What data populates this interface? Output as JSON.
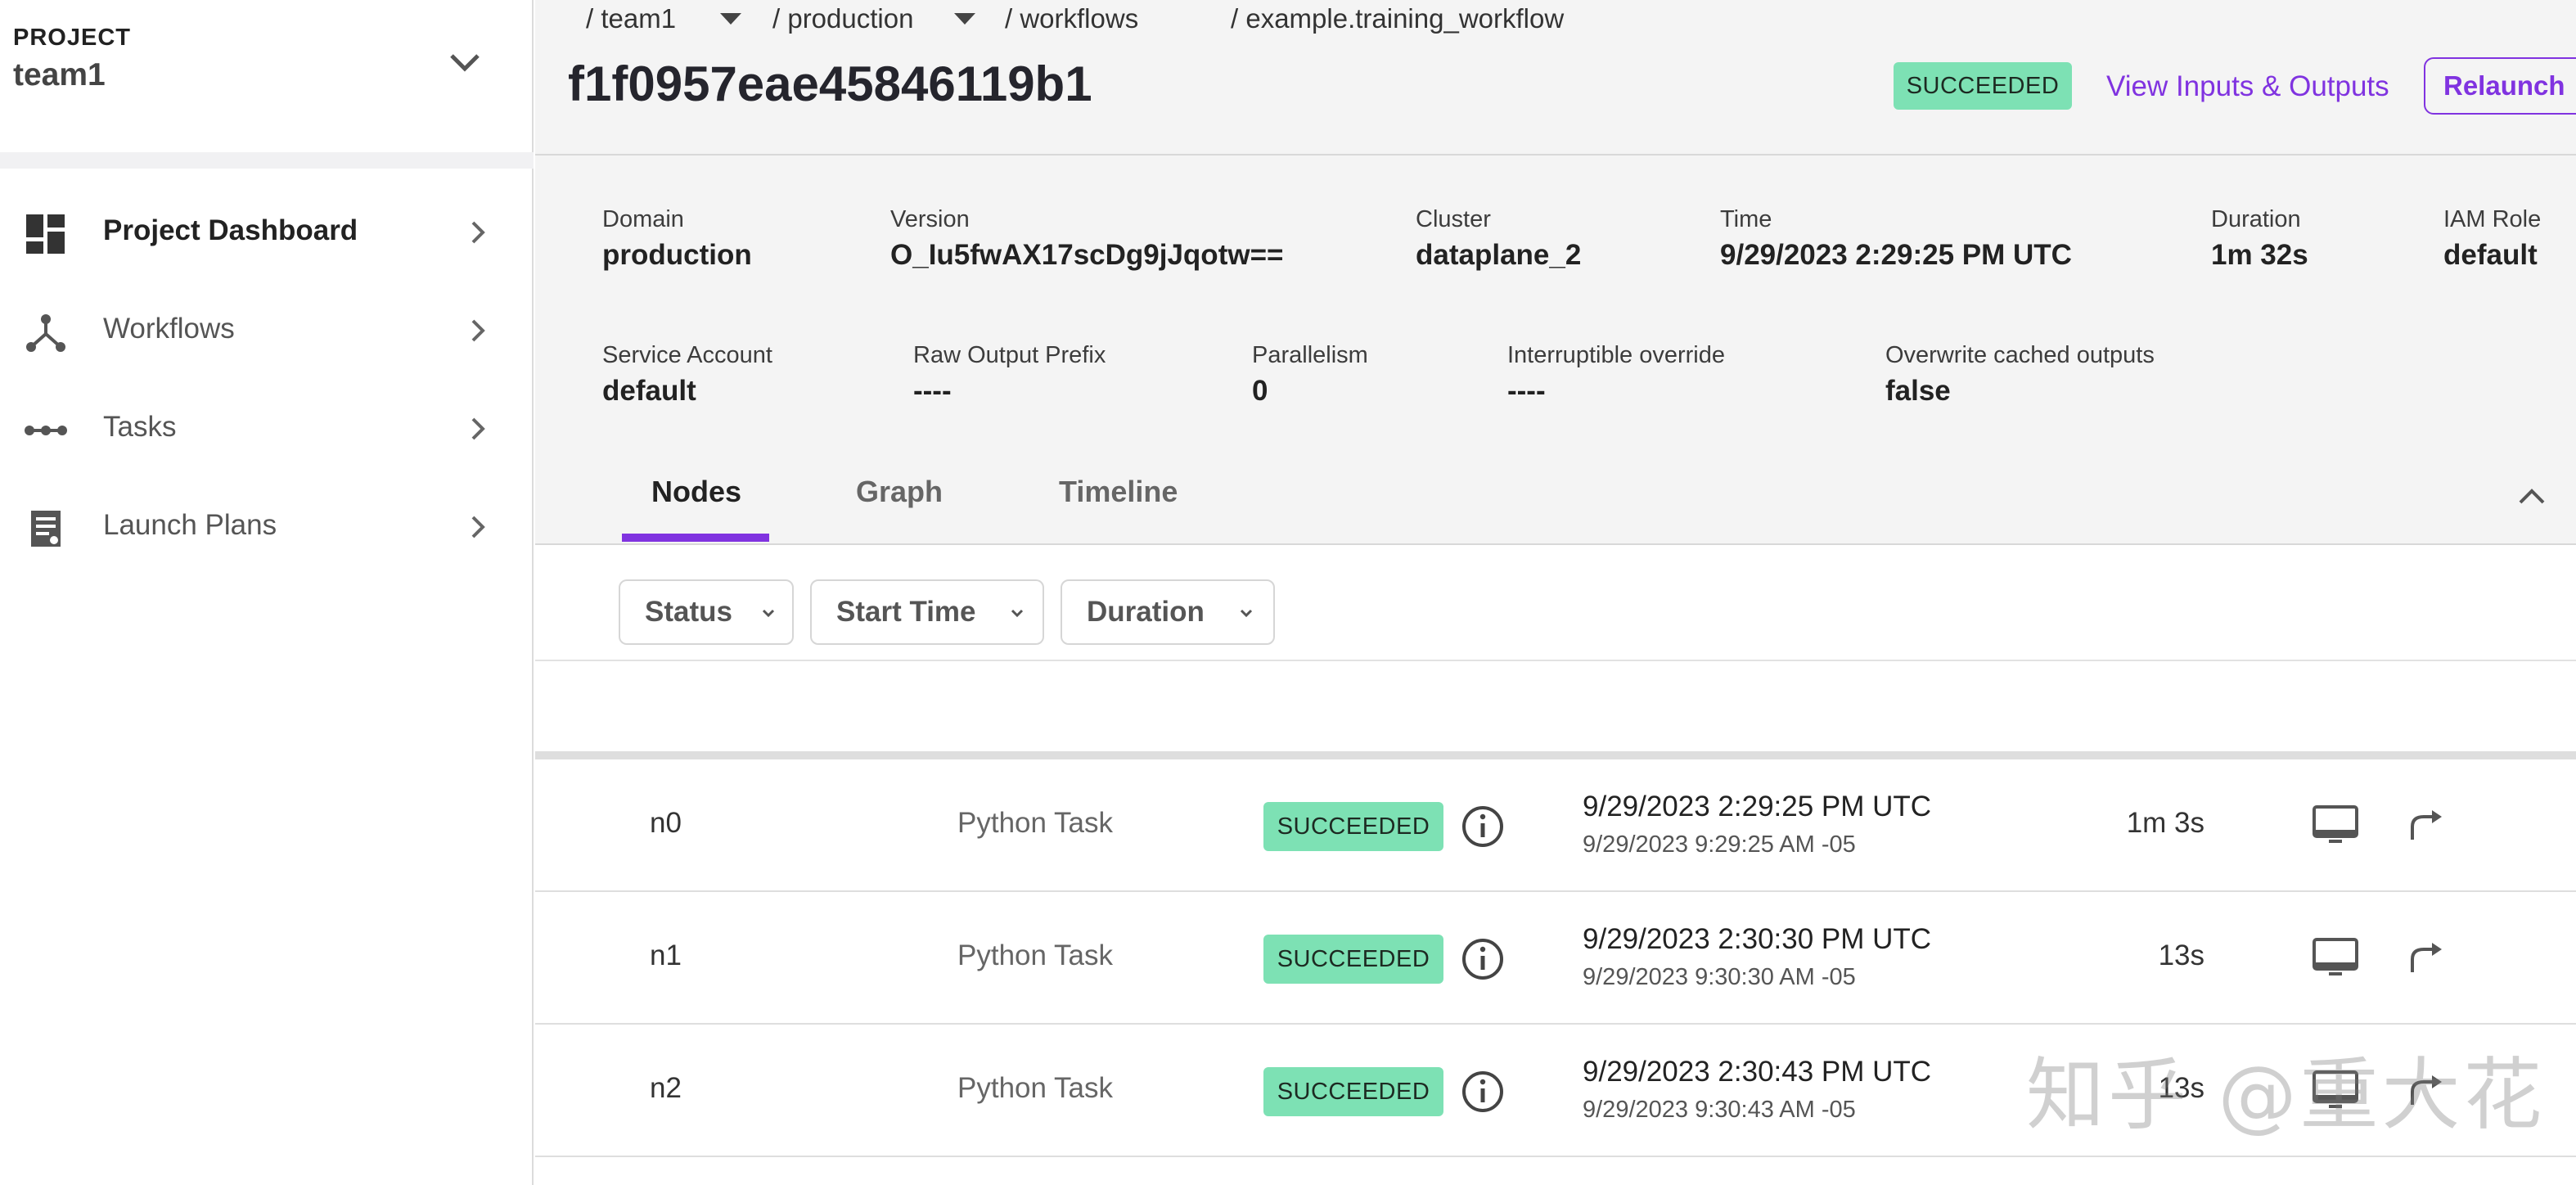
{
  "sidebar": {
    "project_label": "PROJECT",
    "project_name": "team1",
    "items": [
      {
        "label": "Project Dashboard",
        "icon": "dashboard-icon"
      },
      {
        "label": "Workflows",
        "icon": "workflow-icon"
      },
      {
        "label": "Tasks",
        "icon": "tasks-icon"
      },
      {
        "label": "Launch Plans",
        "icon": "launch-plans-icon"
      }
    ]
  },
  "breadcrumb": [
    "/ team1",
    "/ production",
    "/ workflows",
    "/ example.training_workflow"
  ],
  "execution": {
    "id": "f1f0957eae45846119b1",
    "status": "SUCCEEDED",
    "view_io_label": "View Inputs & Outputs",
    "relaunch_label": "Relaunch"
  },
  "details": {
    "domain": {
      "label": "Domain",
      "value": "production"
    },
    "version": {
      "label": "Version",
      "value": "O_Iu5fwAX17scDg9jJqotw=="
    },
    "cluster": {
      "label": "Cluster",
      "value": "dataplane_2"
    },
    "time": {
      "label": "Time",
      "value": "9/29/2023 2:29:25 PM UTC"
    },
    "duration": {
      "label": "Duration",
      "value": "1m 32s"
    },
    "iam_role": {
      "label": "IAM Role",
      "value": "default"
    },
    "service_account": {
      "label": "Service Account",
      "value": "default"
    },
    "raw_output_prefix": {
      "label": "Raw Output Prefix",
      "value": "----"
    },
    "parallelism": {
      "label": "Parallelism",
      "value": "0"
    },
    "interruptible": {
      "label": "Interruptible override",
      "value": "----"
    },
    "overwrite_cache": {
      "label": "Overwrite cached outputs",
      "value": "false"
    }
  },
  "tabs": [
    "Nodes",
    "Graph",
    "Timeline"
  ],
  "active_tab": "Nodes",
  "filters": [
    "Status",
    "Start Time",
    "Duration"
  ],
  "rows": [
    {
      "name": "n0",
      "type": "Python Task",
      "status": "SUCCEEDED",
      "time_utc": "9/29/2023 2:29:25 PM UTC",
      "time_local": "9/29/2023 9:29:25 AM -05",
      "duration": "1m 3s"
    },
    {
      "name": "n1",
      "type": "Python Task",
      "status": "SUCCEEDED",
      "time_utc": "9/29/2023 2:30:30 PM UTC",
      "time_local": "9/29/2023 9:30:30 AM -05",
      "duration": "13s"
    },
    {
      "name": "n2",
      "type": "Python Task",
      "status": "SUCCEEDED",
      "time_utc": "9/29/2023 2:30:43 PM UTC",
      "time_local": "9/29/2023 9:30:43 AM -05",
      "duration": "13s"
    }
  ],
  "watermark": "知乎 @重大花",
  "colors": {
    "accent": "#8033e0",
    "success": "#7de1b4",
    "header_bg": "#f4f4f4"
  }
}
